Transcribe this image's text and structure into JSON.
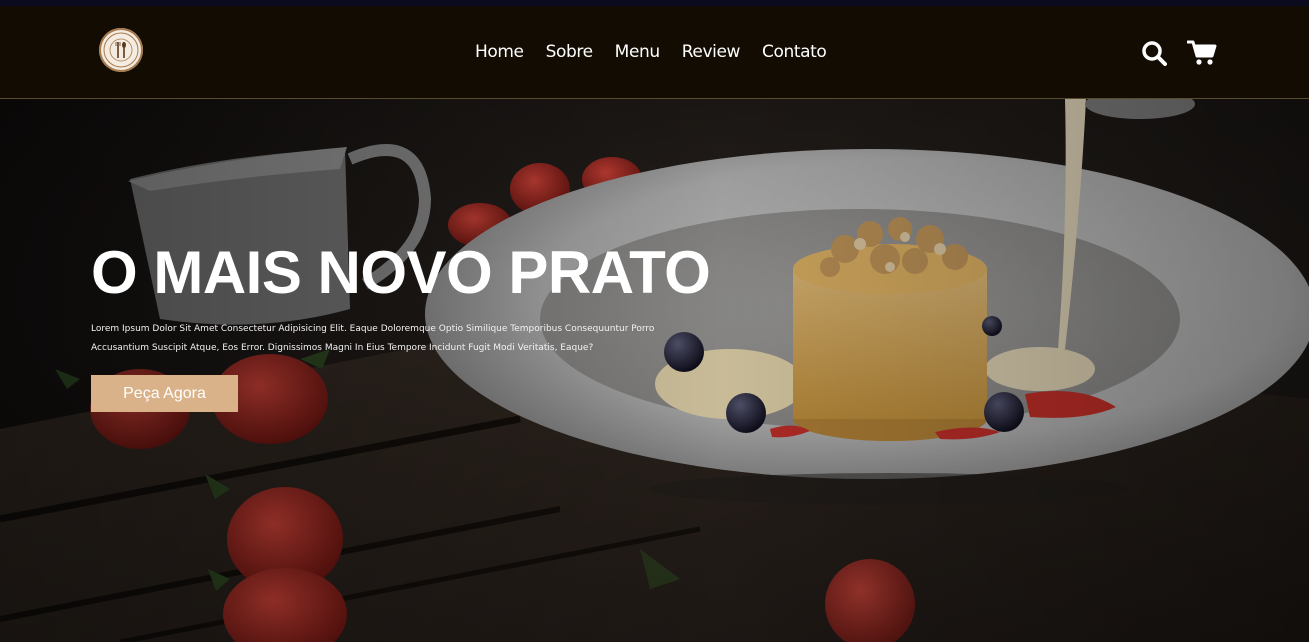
{
  "header": {
    "logo_icon": "restaurant-logo-icon",
    "nav": [
      {
        "label": "Home"
      },
      {
        "label": "Sobre"
      },
      {
        "label": "Menu"
      },
      {
        "label": "Review"
      },
      {
        "label": "Contato"
      }
    ],
    "icons": [
      "search-icon",
      "cart-icon"
    ]
  },
  "hero": {
    "title": "O MAIS NOVO PRATO",
    "text": "Lorem Ipsum Dolor Sit Amet Consectetur Adipisicing Elit. Eaque Doloremque Optio Similique Temporibus Consequuntur Porro Accusantium Suscipit Atque, Eos Error. Dignissimos Magni In Eius Tempore Incidunt Fugit Modi Veritatis, Eaque?",
    "cta_label": "Peça Agora"
  },
  "colors": {
    "header_bg": "#130c03",
    "accent": "#d9b289",
    "text": "#ffffff"
  }
}
